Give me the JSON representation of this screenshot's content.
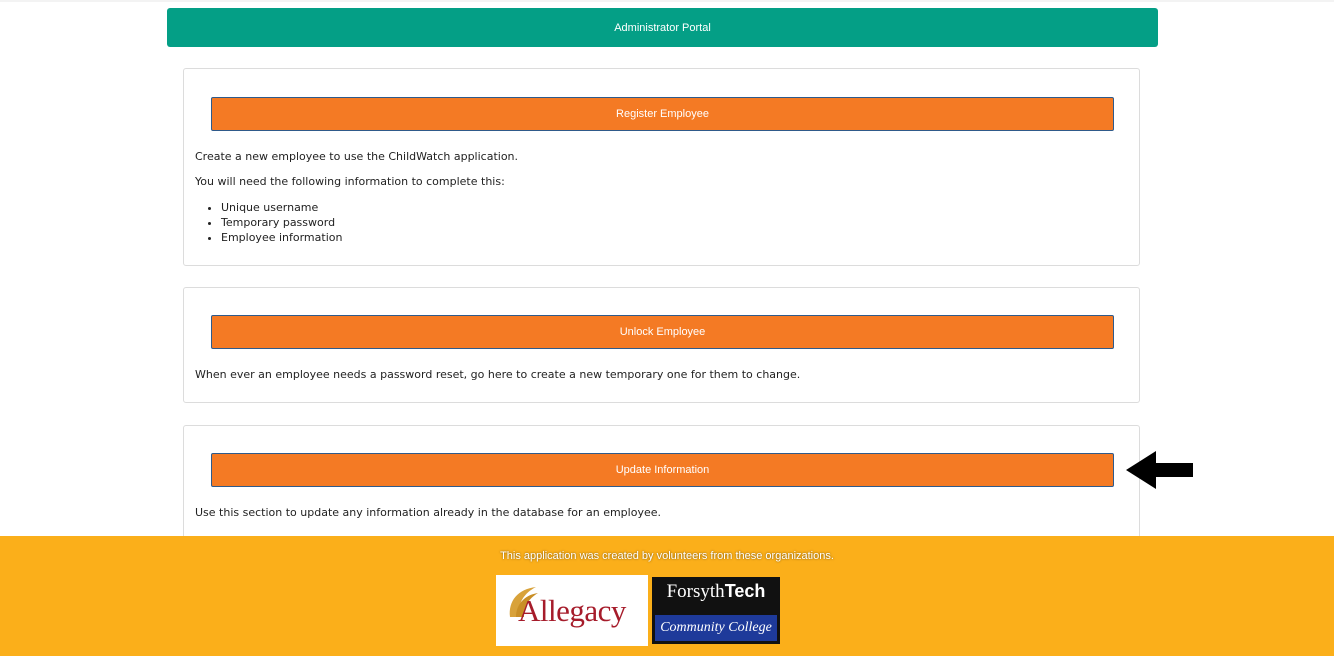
{
  "header": {
    "title": "Administrator Portal"
  },
  "cards": [
    {
      "button_label": "Register Employee",
      "paragraphs": [
        "Create a new employee to use the ChildWatch application.",
        "You will need the following information to complete this:"
      ],
      "list": [
        "Unique username",
        "Temporary password",
        "Employee information"
      ]
    },
    {
      "button_label": "Unlock Employee",
      "paragraphs": [
        "When ever an employee needs a password reset, go here to create a new temporary one for them to change."
      ]
    },
    {
      "button_label": "Update Information",
      "paragraphs": [
        "Use this section to update any information already in the database for an employee."
      ]
    }
  ],
  "footer": {
    "text": "This application was created by volunteers from these organizations.",
    "logos": {
      "allegacy": "Allegacy",
      "forsyth_name": "Forsyth",
      "forsyth_tech": "Tech",
      "forsyth_college": "Community College"
    }
  },
  "annotation": {
    "icon": "arrow-left-icon"
  },
  "colors": {
    "header": "#049f86",
    "button": "#f47a24",
    "footer": "#fbaf1a",
    "allegacy_red": "#a61c2b",
    "forsyth_blue": "#1e3a9a"
  }
}
